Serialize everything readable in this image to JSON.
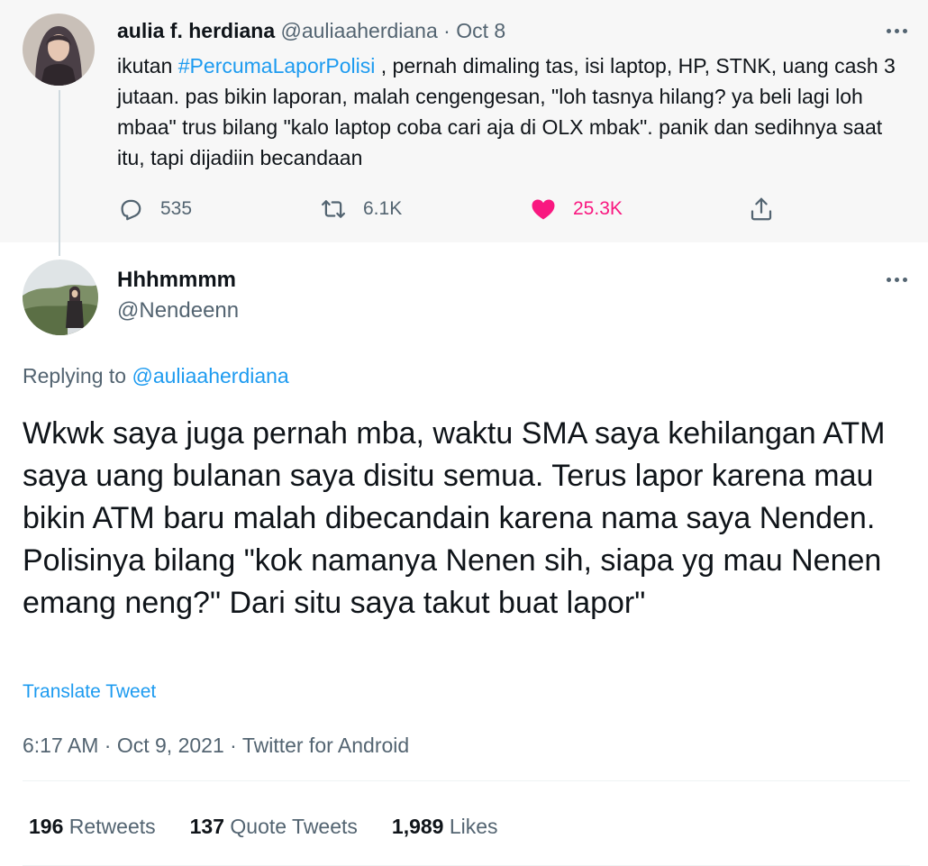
{
  "parent_tweet": {
    "author_name": "aulia f. herdiana",
    "author_handle": "@auliaaherdiana",
    "separator": "·",
    "date": "Oct 8",
    "text_before": "ikutan ",
    "hashtag": "#PercumaLaporPolisi",
    "text_after": " , pernah dimaling tas, isi laptop, HP, STNK, uang cash 3 jutaan. pas bikin laporan, malah cengengesan, \"loh tasnya hilang? ya beli lagi loh mbaa\" trus bilang \"kalo laptop coba cari aja di OLX mbak\". panik dan sedihnya saat itu, tapi dijadiin becandaan",
    "actions": {
      "reply_count": "535",
      "retweet_count": "6.1K",
      "like_count": "25.3K",
      "reply_icon": "reply-icon",
      "retweet_icon": "retweet-icon",
      "like_icon": "heart-icon",
      "share_icon": "share-icon"
    }
  },
  "reply_tweet": {
    "author_name": "Hhhmmmm",
    "author_handle": "@Nendeenn",
    "replying_prefix": "Replying to ",
    "replying_to": "@auliaaherdiana",
    "text": "Wkwk saya juga pernah mba, waktu SMA saya kehilangan ATM saya uang bulanan saya disitu semua. Terus lapor karena mau bikin ATM baru malah dibecandain karena nama saya Nenden. Polisinya bilang \"kok namanya Nenen sih, siapa yg mau Nenen emang neng?\" Dari situ saya takut buat lapor\"",
    "translate_label": "Translate Tweet",
    "time": "6:17 AM",
    "separator": "·",
    "date": "Oct 9, 2021",
    "source": "Twitter for Android",
    "stats": {
      "retweets_count": "196",
      "retweets_label": "Retweets",
      "quotes_count": "137",
      "quotes_label": "Quote Tweets",
      "likes_count": "1,989",
      "likes_label": "Likes"
    }
  },
  "colors": {
    "link_blue": "#1d9bf0",
    "like_pink": "#f91880",
    "secondary_gray": "#536471",
    "parent_background": "#f7f7f7"
  }
}
